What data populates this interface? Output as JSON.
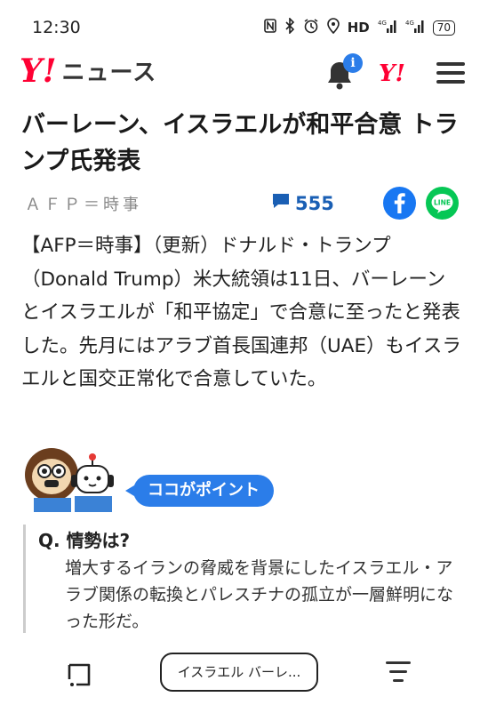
{
  "status_bar": {
    "time": "12:30",
    "network_label": "HD",
    "battery": "70"
  },
  "header": {
    "logo_y": "Y!",
    "logo_text": "ニュース",
    "notification_badge": "i",
    "yahoo_icon": "Y!"
  },
  "article": {
    "headline": "バーレーン、イスラエルが和平合意 トランプ氏発表",
    "source": "ＡＦＰ＝時事",
    "comment_count": "555",
    "body": "【AFP＝時事】（更新）ドナルド・トランプ（Donald Trump）米大統領は11日、バーレーンとイスラエルが「和平協定」で合意に至ったと発表した。先月にはアラブ首長国連邦（UAE）もイスラエルと国交正常化で合意していた。"
  },
  "point": {
    "label": "ココがポイント",
    "question": "Q. 情勢は?",
    "answer": "増大するイランの脅威を背景にしたイスラエル・アラブ関係の転換とパレスチナの孤立が一層鮮明になった形だ。"
  },
  "bottom_bar": {
    "search_text": "イスラエル バーレ..."
  },
  "colors": {
    "brand_red": "#ff0033",
    "accent_blue": "#2b7de9",
    "facebook": "#1877f2",
    "line": "#06c755"
  },
  "icons": [
    "nfc-icon",
    "bluetooth-icon",
    "alarm-icon",
    "location-icon",
    "signal-icon",
    "battery-icon",
    "bell-icon",
    "menu-icon",
    "comment-icon",
    "facebook-icon",
    "line-icon",
    "tabs-icon",
    "sort-icon"
  ]
}
